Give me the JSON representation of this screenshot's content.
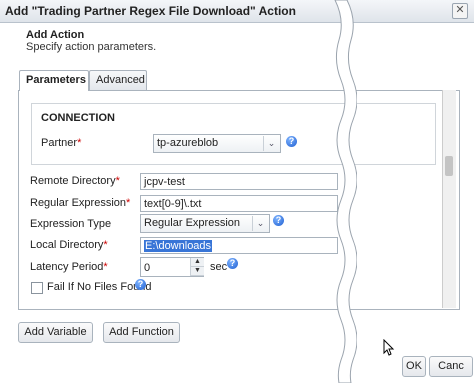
{
  "window": {
    "title": "Add \"Trading Partner Regex File Download\" Action",
    "close_icon": "close-icon"
  },
  "header": {
    "title": "Add Action",
    "subtitle": "Specify action parameters."
  },
  "tabs": [
    {
      "label": "Parameters",
      "active": true
    },
    {
      "label": "Advanced",
      "active": false
    }
  ],
  "connection": {
    "title": "CONNECTION",
    "partner_label": "Partner",
    "partner_value": "tp-azureblob"
  },
  "form": {
    "remote_directory_label": "Remote Directory",
    "remote_directory_value": "jcpv-test",
    "regular_expression_label": "Regular Expression",
    "regular_expression_value": "text[0-9]\\.txt",
    "expression_type_label": "Expression Type",
    "expression_type_value": "Regular Expression",
    "local_directory_label": "Local Directory",
    "local_directory_value": "E:\\downloads",
    "latency_label": "Latency Period",
    "latency_value": "0",
    "latency_unit": "sec",
    "fail_label": "Fail If No Files Found"
  },
  "required_marker": "*",
  "buttons": {
    "add_variable": "Add Variable",
    "add_function": "Add Function",
    "ok": "OK",
    "cancel": "Canc"
  },
  "colors": {
    "required": "#cc0000",
    "selection": "#3875d7",
    "help": "#1f5fd1"
  }
}
